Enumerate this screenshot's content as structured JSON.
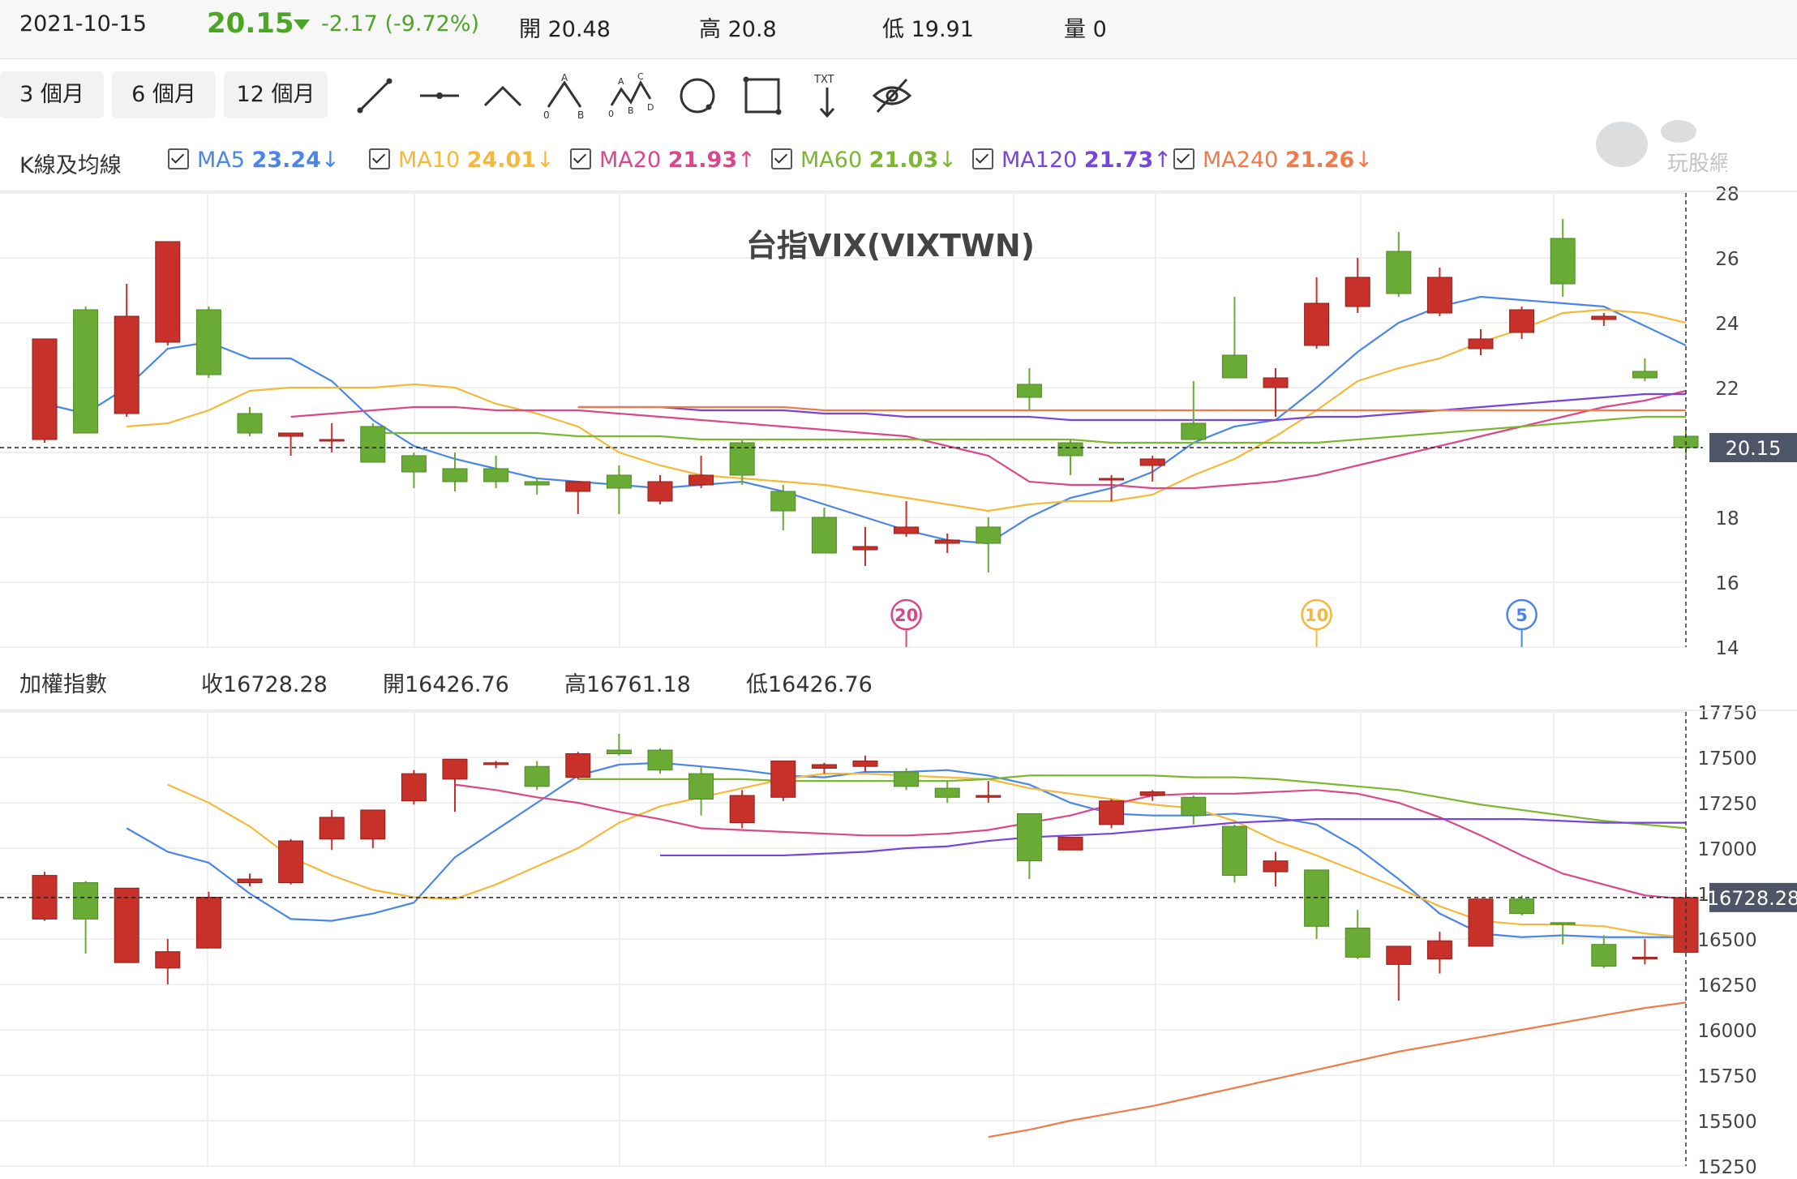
{
  "header": {
    "date": "2021-10-15",
    "price": "20.15",
    "change": "-2.17 (-9.72%)",
    "open_label": "開 20.48",
    "high_label": "高 20.8",
    "low_label": "低 19.91",
    "volume_label": "量 0"
  },
  "toolbar": {
    "ranges": [
      "3 個月",
      "6 個月",
      "12 個月"
    ],
    "tools": [
      "line-tool-icon",
      "horizontal-line-tool-icon",
      "angle-tool-icon",
      "abc-pattern-tool-icon",
      "abcd-pattern-tool-icon",
      "circle-tool-icon",
      "rectangle-tool-icon",
      "text-tool-icon",
      "hide-drawings-icon"
    ],
    "text_tool_label": "TXT"
  },
  "ma_bar": {
    "title": "K線及均線",
    "items": [
      {
        "name": "MA5",
        "value": "23.24",
        "dir": "↓",
        "color": "#4a86e8"
      },
      {
        "name": "MA10",
        "value": "24.01",
        "dir": "↓",
        "color": "#f4b93a"
      },
      {
        "name": "MA20",
        "value": "21.93",
        "dir": "↑",
        "color": "#d9488a"
      },
      {
        "name": "MA60",
        "value": "21.03",
        "dir": "↓",
        "color": "#7bb72f"
      },
      {
        "name": "MA120",
        "value": "21.73",
        "dir": "↑",
        "color": "#7744dd"
      },
      {
        "name": "MA240",
        "value": "21.26",
        "dir": "↓",
        "color": "#ef7a4a"
      }
    ]
  },
  "watermark": "玩股網",
  "index_bar": {
    "title": "加權指數",
    "close": "收16728.28",
    "open": "開16426.76",
    "high": "高16761.18",
    "low": "低16426.76"
  },
  "colors": {
    "up": "#c8302a",
    "down": "#6aab35",
    "last_label_bg": "#4d5566"
  },
  "chart_data": [
    {
      "type": "candlestick",
      "title": "台指VIX(VIXTWN)",
      "ylim": [
        14,
        28
      ],
      "yticks": [
        14,
        16,
        18,
        20,
        22,
        24,
        26,
        28
      ],
      "last_value_label": "20.15",
      "candles": [
        {
          "o": 20.4,
          "h": 23.5,
          "l": 20.3,
          "c": 23.5
        },
        {
          "o": 24.4,
          "h": 24.5,
          "l": 20.6,
          "c": 20.6
        },
        {
          "o": 21.2,
          "h": 25.2,
          "l": 21.1,
          "c": 24.2
        },
        {
          "o": 23.4,
          "h": 26.5,
          "l": 23.3,
          "c": 26.5
        },
        {
          "o": 24.4,
          "h": 24.5,
          "l": 22.3,
          "c": 22.4
        },
        {
          "o": 21.2,
          "h": 21.4,
          "l": 20.5,
          "c": 20.6
        },
        {
          "o": 20.5,
          "h": 20.6,
          "l": 19.9,
          "c": 20.6
        },
        {
          "o": 20.4,
          "h": 20.9,
          "l": 20.0,
          "c": 20.4
        },
        {
          "o": 20.8,
          "h": 20.9,
          "l": 19.7,
          "c": 19.7
        },
        {
          "o": 19.9,
          "h": 20.0,
          "l": 18.9,
          "c": 19.4
        },
        {
          "o": 19.5,
          "h": 20.0,
          "l": 18.8,
          "c": 19.1
        },
        {
          "o": 19.5,
          "h": 19.9,
          "l": 18.9,
          "c": 19.1
        },
        {
          "o": 19.1,
          "h": 19.2,
          "l": 18.7,
          "c": 19.0
        },
        {
          "o": 18.8,
          "h": 19.1,
          "l": 18.1,
          "c": 19.1
        },
        {
          "o": 19.3,
          "h": 19.6,
          "l": 18.1,
          "c": 18.9
        },
        {
          "o": 18.5,
          "h": 19.3,
          "l": 18.4,
          "c": 19.1
        },
        {
          "o": 19.0,
          "h": 19.9,
          "l": 18.9,
          "c": 19.3
        },
        {
          "o": 20.3,
          "h": 20.4,
          "l": 19.0,
          "c": 19.3
        },
        {
          "o": 18.8,
          "h": 19.0,
          "l": 17.6,
          "c": 18.2
        },
        {
          "o": 18.0,
          "h": 18.3,
          "l": 16.9,
          "c": 16.9
        },
        {
          "o": 17.0,
          "h": 17.7,
          "l": 16.5,
          "c": 17.1
        },
        {
          "o": 17.5,
          "h": 18.5,
          "l": 17.4,
          "c": 17.7
        },
        {
          "o": 17.2,
          "h": 17.5,
          "l": 16.9,
          "c": 17.3
        },
        {
          "o": 17.7,
          "h": 18.0,
          "l": 16.3,
          "c": 17.2
        },
        {
          "o": 22.1,
          "h": 22.6,
          "l": 21.3,
          "c": 21.7
        },
        {
          "o": 20.3,
          "h": 20.4,
          "l": 19.3,
          "c": 19.9
        },
        {
          "o": 19.2,
          "h": 19.3,
          "l": 18.5,
          "c": 19.2
        },
        {
          "o": 19.6,
          "h": 19.9,
          "l": 19.1,
          "c": 19.8
        },
        {
          "o": 20.9,
          "h": 22.2,
          "l": 20.4,
          "c": 20.4
        },
        {
          "o": 23.0,
          "h": 24.8,
          "l": 22.5,
          "c": 22.3
        },
        {
          "o": 22.0,
          "h": 22.6,
          "l": 21.1,
          "c": 22.3
        },
        {
          "o": 23.3,
          "h": 25.4,
          "l": 23.2,
          "c": 24.6
        },
        {
          "o": 24.5,
          "h": 26.0,
          "l": 24.3,
          "c": 25.4
        },
        {
          "o": 26.2,
          "h": 26.8,
          "l": 24.8,
          "c": 24.9
        },
        {
          "o": 24.3,
          "h": 25.7,
          "l": 24.2,
          "c": 25.4
        },
        {
          "o": 23.2,
          "h": 23.8,
          "l": 23.0,
          "c": 23.5
        },
        {
          "o": 23.7,
          "h": 24.5,
          "l": 23.5,
          "c": 24.4
        },
        {
          "o": 26.6,
          "h": 27.2,
          "l": 24.8,
          "c": 25.2
        },
        {
          "o": 24.1,
          "h": 24.3,
          "l": 23.9,
          "c": 24.2
        },
        {
          "o": 22.5,
          "h": 22.9,
          "l": 22.2,
          "c": 22.3
        },
        {
          "o": 20.5,
          "h": 20.8,
          "l": 19.9,
          "c": 20.15
        }
      ],
      "ma": {
        "MA5": [
          21.5,
          21.2,
          22.0,
          23.2,
          23.4,
          22.9,
          22.9,
          22.2,
          21.0,
          20.2,
          19.8,
          19.5,
          19.2,
          19.1,
          19.0,
          18.9,
          19.0,
          19.1,
          18.8,
          18.4,
          18.0,
          17.6,
          17.3,
          17.2,
          18.0,
          18.6,
          18.9,
          19.4,
          20.3,
          20.8,
          21.0,
          22.0,
          23.1,
          24.0,
          24.5,
          24.8,
          24.7,
          24.6,
          24.5,
          23.9,
          23.3
        ],
        "MA10": [
          20.8,
          20.9,
          21.3,
          21.9,
          22.0,
          22.0,
          22.0,
          22.1,
          22.0,
          21.5,
          21.2,
          20.8,
          20.0,
          19.6,
          19.3,
          19.2,
          19.1,
          19.0,
          18.8,
          18.6,
          18.4,
          18.2,
          18.4,
          18.5,
          18.5,
          18.7,
          19.3,
          19.8,
          20.5,
          21.3,
          22.2,
          22.6,
          22.9,
          23.4,
          23.8,
          24.3,
          24.4,
          24.3,
          24.0
        ],
        "MA20": [
          21.1,
          21.2,
          21.3,
          21.4,
          21.4,
          21.3,
          21.3,
          21.3,
          21.2,
          21.1,
          21.0,
          20.9,
          20.8,
          20.7,
          20.6,
          20.5,
          20.2,
          19.9,
          19.1,
          19.0,
          19.0,
          18.9,
          18.9,
          19.0,
          19.1,
          19.3,
          19.6,
          19.9,
          20.2,
          20.5,
          20.8,
          21.1,
          21.4,
          21.6,
          21.9
        ],
        "MA60": [
          20.6,
          20.6,
          20.6,
          20.6,
          20.6,
          20.5,
          20.5,
          20.5,
          20.4,
          20.4,
          20.4,
          20.4,
          20.4,
          20.4,
          20.4,
          20.4,
          20.4,
          20.4,
          20.3,
          20.3,
          20.3,
          20.3,
          20.3,
          20.3,
          20.4,
          20.5,
          20.6,
          20.7,
          20.8,
          20.9,
          21.0,
          21.1,
          21.1
        ],
        "MA120": [
          21.4,
          21.4,
          21.4,
          21.3,
          21.3,
          21.3,
          21.2,
          21.2,
          21.1,
          21.1,
          21.1,
          21.1,
          21.0,
          21.0,
          21.0,
          21.0,
          21.0,
          21.0,
          21.1,
          21.1,
          21.2,
          21.3,
          21.4,
          21.5,
          21.6,
          21.7,
          21.8,
          21.8
        ],
        "MA240": [
          21.4,
          21.4,
          21.4,
          21.4,
          21.4,
          21.4,
          21.3,
          21.3,
          21.3,
          21.3,
          21.3,
          21.3,
          21.3,
          21.3,
          21.3,
          21.3,
          21.3,
          21.3,
          21.3,
          21.3,
          21.3,
          21.3,
          21.3,
          21.3,
          21.3,
          21.3,
          21.3,
          21.3
        ]
      },
      "markers": [
        {
          "label": "20",
          "index": 21,
          "color": "#d9488a"
        },
        {
          "label": "10",
          "index": 31,
          "color": "#f4b93a"
        },
        {
          "label": "5",
          "index": 36,
          "color": "#4a86e8"
        }
      ]
    },
    {
      "type": "candlestick",
      "title": "加權指數",
      "ylim": [
        15250,
        17750
      ],
      "yticks": [
        15250,
        15500,
        15750,
        16000,
        16250,
        16500,
        16750,
        17000,
        17250,
        17500,
        17750
      ],
      "last_value_label": "16728.28",
      "candles": [
        {
          "o": 16610,
          "h": 16870,
          "l": 16600,
          "c": 16850
        },
        {
          "o": 16810,
          "h": 16820,
          "l": 16420,
          "c": 16610
        },
        {
          "o": 16370,
          "h": 16780,
          "l": 16370,
          "c": 16780
        },
        {
          "o": 16340,
          "h": 16500,
          "l": 16250,
          "c": 16430
        },
        {
          "o": 16450,
          "h": 16760,
          "l": 16450,
          "c": 16730
        },
        {
          "o": 16810,
          "h": 16860,
          "l": 16790,
          "c": 16830
        },
        {
          "o": 16810,
          "h": 17050,
          "l": 16800,
          "c": 17040
        },
        {
          "o": 17050,
          "h": 17210,
          "l": 16990,
          "c": 17170
        },
        {
          "o": 17050,
          "h": 17210,
          "l": 17000,
          "c": 17210
        },
        {
          "o": 17260,
          "h": 17430,
          "l": 17240,
          "c": 17410
        },
        {
          "o": 17380,
          "h": 17490,
          "l": 17200,
          "c": 17490
        },
        {
          "o": 17460,
          "h": 17480,
          "l": 17440,
          "c": 17470
        },
        {
          "o": 17450,
          "h": 17480,
          "l": 17320,
          "c": 17340
        },
        {
          "o": 17390,
          "h": 17530,
          "l": 17380,
          "c": 17520
        },
        {
          "o": 17540,
          "h": 17630,
          "l": 17510,
          "c": 17520
        },
        {
          "o": 17540,
          "h": 17550,
          "l": 17410,
          "c": 17430
        },
        {
          "o": 17410,
          "h": 17450,
          "l": 17180,
          "c": 17270
        },
        {
          "o": 17140,
          "h": 17320,
          "l": 17110,
          "c": 17290
        },
        {
          "o": 17280,
          "h": 17480,
          "l": 17260,
          "c": 17480
        },
        {
          "o": 17440,
          "h": 17470,
          "l": 17410,
          "c": 17460
        },
        {
          "o": 17450,
          "h": 17510,
          "l": 17420,
          "c": 17480
        },
        {
          "o": 17420,
          "h": 17440,
          "l": 17320,
          "c": 17340
        },
        {
          "o": 17330,
          "h": 17370,
          "l": 17250,
          "c": 17280
        },
        {
          "o": 17280,
          "h": 17370,
          "l": 17250,
          "c": 17290
        },
        {
          "o": 17190,
          "h": 17190,
          "l": 16830,
          "c": 16930
        },
        {
          "o": 16990,
          "h": 17060,
          "l": 16990,
          "c": 17060
        },
        {
          "o": 17130,
          "h": 17270,
          "l": 17110,
          "c": 17260
        },
        {
          "o": 17290,
          "h": 17320,
          "l": 17260,
          "c": 17310
        },
        {
          "o": 17280,
          "h": 17290,
          "l": 17130,
          "c": 17180
        },
        {
          "o": 17120,
          "h": 17130,
          "l": 16810,
          "c": 16850
        },
        {
          "o": 16870,
          "h": 16980,
          "l": 16790,
          "c": 16930
        },
        {
          "o": 16880,
          "h": 16880,
          "l": 16500,
          "c": 16570
        },
        {
          "o": 16560,
          "h": 16660,
          "l": 16390,
          "c": 16400
        },
        {
          "o": 16360,
          "h": 16460,
          "l": 16160,
          "c": 16460
        },
        {
          "o": 16390,
          "h": 16540,
          "l": 16310,
          "c": 16490
        },
        {
          "o": 16460,
          "h": 16720,
          "l": 16460,
          "c": 16720
        },
        {
          "o": 16720,
          "h": 16740,
          "l": 16630,
          "c": 16640
        },
        {
          "o": 16590,
          "h": 16590,
          "l": 16470,
          "c": 16580
        },
        {
          "o": 16470,
          "h": 16520,
          "l": 16340,
          "c": 16350
        },
        {
          "o": 16390,
          "h": 16500,
          "l": 16360,
          "c": 16400
        },
        {
          "o": 16426.76,
          "h": 16761.18,
          "l": 16426.76,
          "c": 16728.28
        }
      ],
      "ma": {
        "MA5": [
          17110,
          16980,
          16920,
          16750,
          16610,
          16600,
          16640,
          16700,
          16950,
          17100,
          17250,
          17400,
          17460,
          17470,
          17450,
          17430,
          17400,
          17390,
          17420,
          17420,
          17430,
          17400,
          17350,
          17250,
          17190,
          17180,
          17180,
          17190,
          17170,
          17130,
          17000,
          16830,
          16640,
          16530,
          16510,
          16520,
          16510,
          16510,
          16510
        ],
        "MA10": [
          17350,
          17250,
          17120,
          16950,
          16850,
          16770,
          16730,
          16720,
          16800,
          16900,
          17000,
          17140,
          17230,
          17280,
          17330,
          17380,
          17410,
          17410,
          17400,
          17390,
          17380,
          17330,
          17300,
          17270,
          17240,
          17220,
          17150,
          17040,
          16960,
          16870,
          16780,
          16680,
          16600,
          16580,
          16580,
          16570,
          16530,
          16510
        ],
        "MA20": [
          17350,
          17320,
          17280,
          17250,
          17200,
          17160,
          17110,
          17100,
          17090,
          17080,
          17070,
          17070,
          17080,
          17100,
          17140,
          17180,
          17240,
          17290,
          17300,
          17300,
          17310,
          17320,
          17300,
          17250,
          17170,
          17070,
          16960,
          16860,
          16800,
          16740,
          16720
        ],
        "MA60": [
          17380,
          17380,
          17380,
          17380,
          17380,
          17370,
          17370,
          17370,
          17370,
          17370,
          17380,
          17400,
          17400,
          17400,
          17400,
          17390,
          17390,
          17380,
          17360,
          17340,
          17320,
          17280,
          17240,
          17210,
          17180,
          17150,
          17130,
          17110
        ],
        "MA120": [
          16960,
          16960,
          16960,
          16960,
          16970,
          16980,
          17000,
          17010,
          17040,
          17060,
          17070,
          17080,
          17100,
          17120,
          17140,
          17150,
          17160,
          17160,
          17160,
          17160,
          17160,
          17160,
          17150,
          17140,
          17140,
          17140
        ],
        "MA240": [
          15410,
          15450,
          15500,
          15540,
          15580,
          15630,
          15680,
          15730,
          15780,
          15830,
          15880,
          15920,
          15960,
          16000,
          16040,
          16080,
          16120,
          16150
        ]
      }
    }
  ]
}
